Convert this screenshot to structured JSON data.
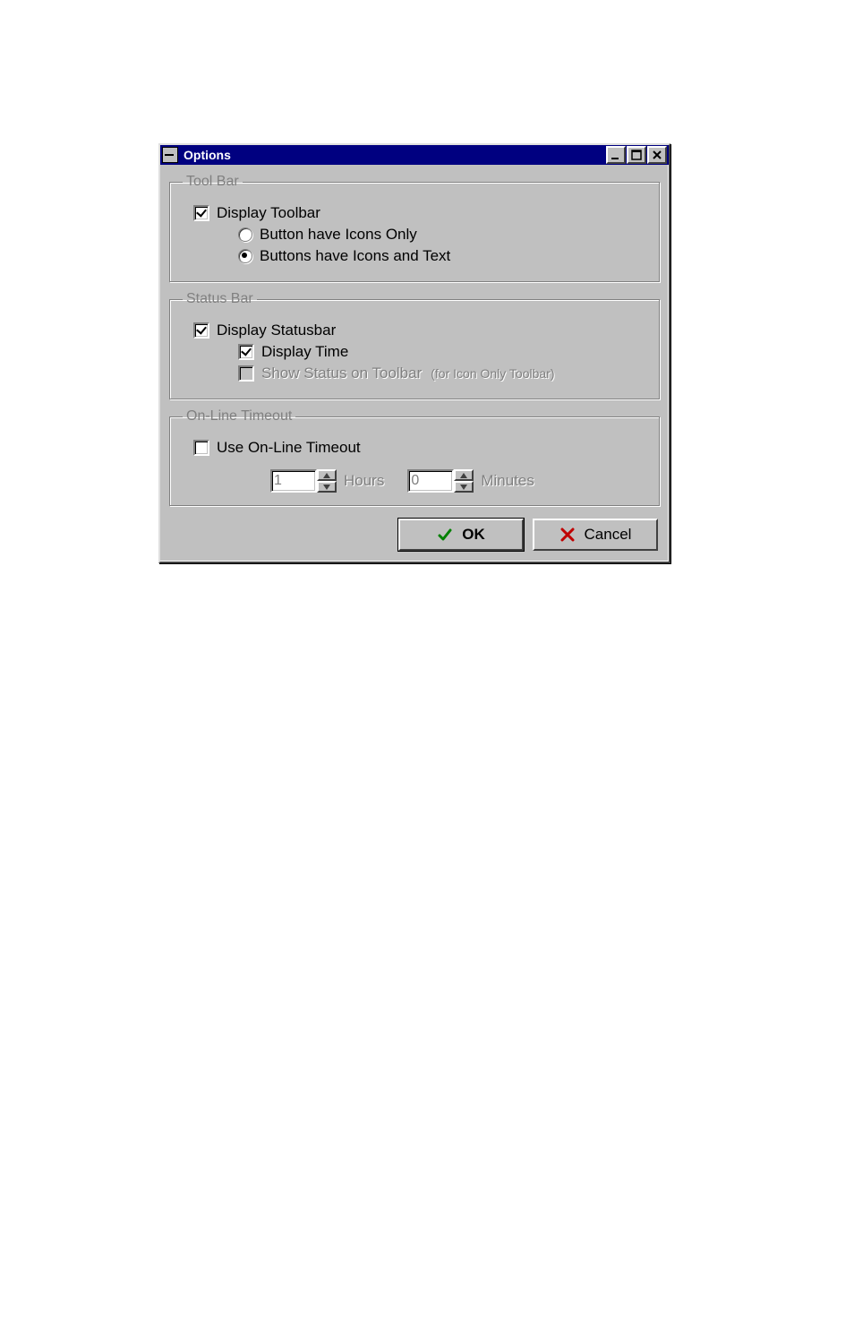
{
  "window": {
    "title": "Options"
  },
  "groups": {
    "toolbar": {
      "legend": "Tool Bar",
      "display_toolbar": {
        "label": "Display Toolbar",
        "checked": true
      },
      "icons_only": {
        "label": "Button have Icons Only",
        "selected": false
      },
      "icons_text": {
        "label": "Buttons have Icons and Text",
        "selected": true
      }
    },
    "statusbar": {
      "legend": "Status Bar",
      "display_statusbar": {
        "label": "Display Statusbar",
        "checked": true
      },
      "display_time": {
        "label": "Display Time",
        "checked": true
      },
      "show_status_on_toolbar": {
        "label": "Show Status on Toolbar",
        "checked": false,
        "enabled": false,
        "hint": "(for Icon Only Toolbar)"
      }
    },
    "timeout": {
      "legend": "On-Line Timeout",
      "use_timeout": {
        "label": "Use On-Line Timeout",
        "checked": false
      },
      "hours": {
        "value": "1",
        "label": "Hours",
        "enabled": false
      },
      "minutes": {
        "value": "0",
        "label": "Minutes",
        "enabled": false
      }
    }
  },
  "buttons": {
    "ok": "OK",
    "cancel": "Cancel"
  }
}
